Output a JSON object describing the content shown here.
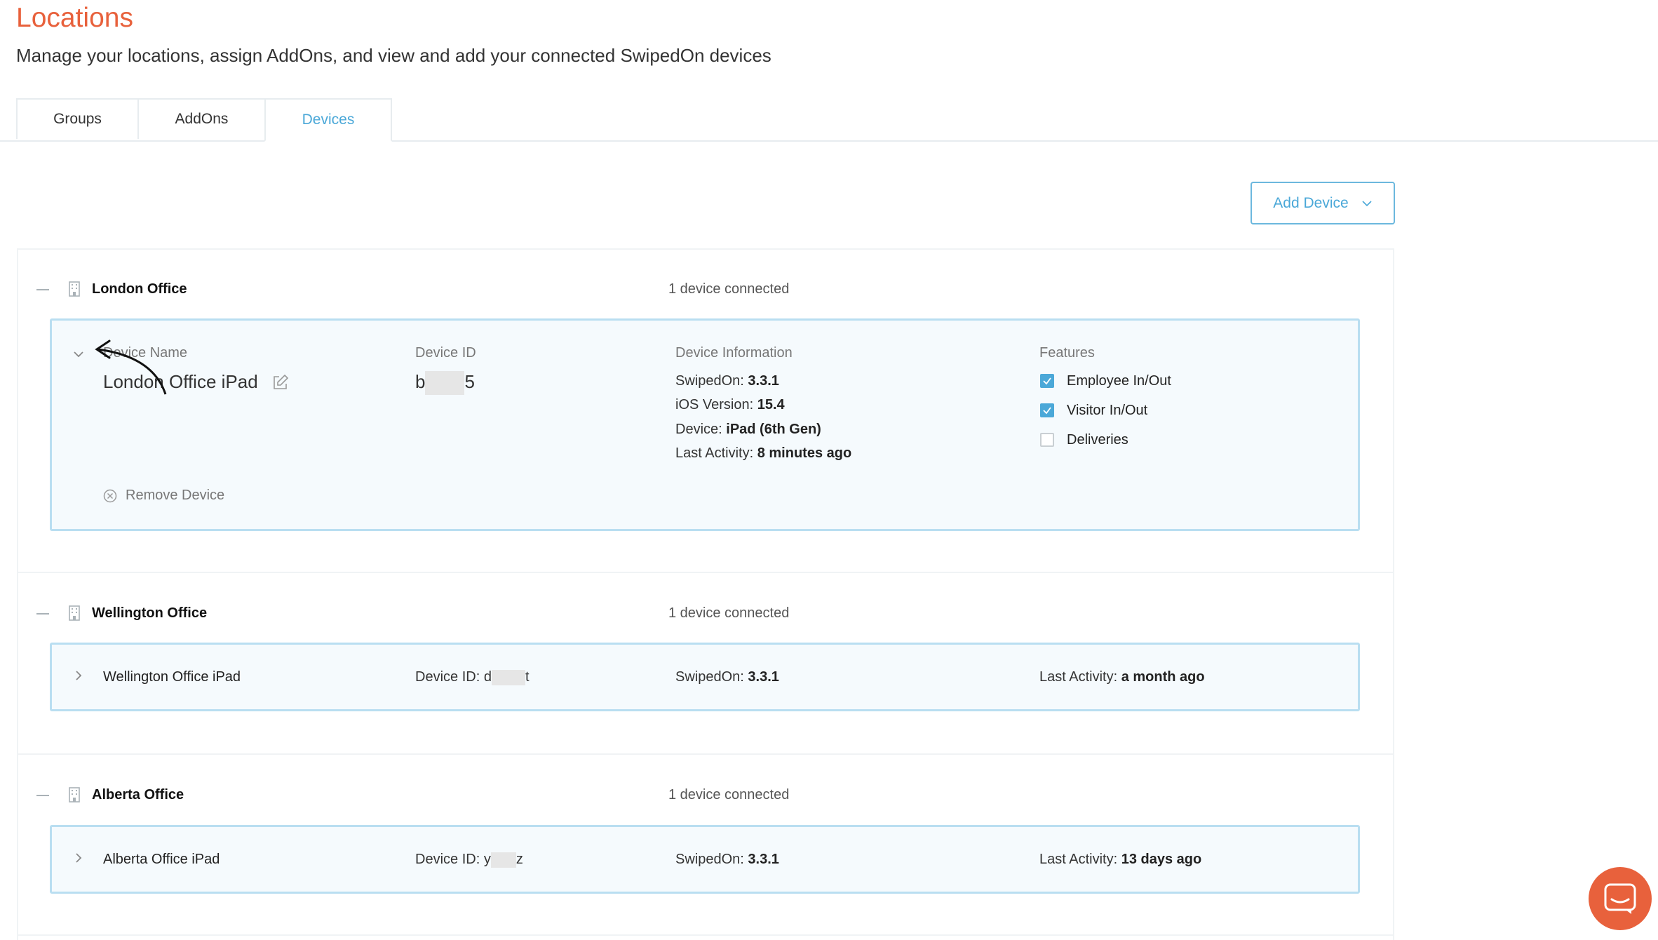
{
  "page": {
    "title": "Locations",
    "subtitle": "Manage your locations, assign AddOns, and view and add your connected SwipedOn devices"
  },
  "tabs": [
    {
      "label": "Groups"
    },
    {
      "label": "AddOns"
    },
    {
      "label": "Devices",
      "active": true
    }
  ],
  "toolbar": {
    "add_device_label": "Add Device"
  },
  "locations": [
    {
      "name": "London Office",
      "count": "1 device connected",
      "device": {
        "expanded": true,
        "name_label": "Device Name",
        "name": "London Office iPad",
        "id_label": "Device ID",
        "id_prefix": "b",
        "id_suffix": "5",
        "info_label": "Device Information",
        "info": [
          {
            "label": "SwipedOn:",
            "value": "3.3.1"
          },
          {
            "label": "iOS Version:",
            "value": "15.4"
          },
          {
            "label": "Device:",
            "value": "iPad (6th Gen)"
          },
          {
            "label": "Last Activity:",
            "value": "8 minutes ago"
          }
        ],
        "features_label": "Features",
        "features": [
          {
            "label": "Employee In/Out",
            "checked": true
          },
          {
            "label": "Visitor In/Out",
            "checked": true
          },
          {
            "label": "Deliveries",
            "checked": false
          }
        ],
        "remove_label": "Remove Device"
      }
    },
    {
      "name": "Wellington Office",
      "count": "1 device connected",
      "device": {
        "expanded": false,
        "name": "Wellington Office iPad",
        "id_label": "Device ID:",
        "id_prefix": "d",
        "id_suffix": "t",
        "swipedon_label": "SwipedOn:",
        "swipedon_value": "3.3.1",
        "activity_label": "Last Activity:",
        "activity_value": "a month ago"
      }
    },
    {
      "name": "Alberta Office",
      "count": "1 device connected",
      "device": {
        "expanded": false,
        "name": "Alberta Office iPad",
        "id_label": "Device ID:",
        "id_prefix": "y",
        "id_suffix": "z",
        "swipedon_label": "SwipedOn:",
        "swipedon_value": "3.3.1",
        "activity_label": "Last Activity:",
        "activity_value": "13 days ago"
      }
    }
  ],
  "icons": {
    "collapse": "minus-icon",
    "building": "building-icon",
    "chevron_down": "chevron-down-icon",
    "chevron_right": "chevron-right-icon",
    "edit": "edit-icon",
    "remove": "close-circle-icon",
    "chat": "chat-icon"
  },
  "colors": {
    "brand": "#e8613c",
    "accent": "#4ba8d8",
    "card_border": "#b9def1",
    "card_bg": "#f5fafd"
  }
}
